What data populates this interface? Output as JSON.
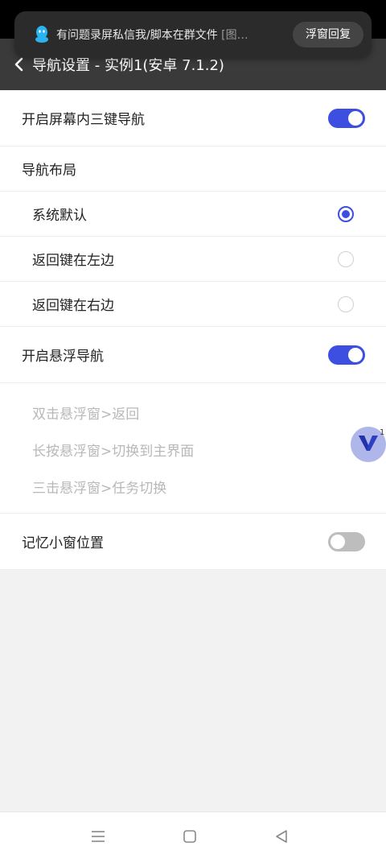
{
  "notification": {
    "text": "有问题录屏私信我/脚本在群文件",
    "suffix": "[图…",
    "button_label": "浮窗回复"
  },
  "app_bar": {
    "title": "导航设置 - 实例1(安卓 7.1.2)"
  },
  "settings": {
    "three_key_nav": {
      "label": "开启屏幕内三键导航",
      "enabled": true
    },
    "layout_header": "导航布局",
    "layout_options": [
      {
        "label": "系统默认",
        "selected": true
      },
      {
        "label": "返回键在左边",
        "selected": false
      },
      {
        "label": "返回键在右边",
        "selected": false
      }
    ],
    "floating_nav": {
      "label": "开启悬浮导航",
      "enabled": true
    },
    "floating_actions": [
      "双击悬浮窗>返回",
      "长按悬浮窗>切换到主界面",
      "三击悬浮窗>任务切换"
    ],
    "remember_position": {
      "label": "记忆小窗位置",
      "enabled": false
    }
  },
  "floating_widget": {
    "badge": "1"
  },
  "colors": {
    "accent": "#3d4fe0",
    "app_bar": "#3a3a3a",
    "toggle_off": "#bdbdbd"
  },
  "icons": [
    "qq-icon",
    "back-icon",
    "menu-icon",
    "home-icon",
    "back-triangle-icon"
  ]
}
